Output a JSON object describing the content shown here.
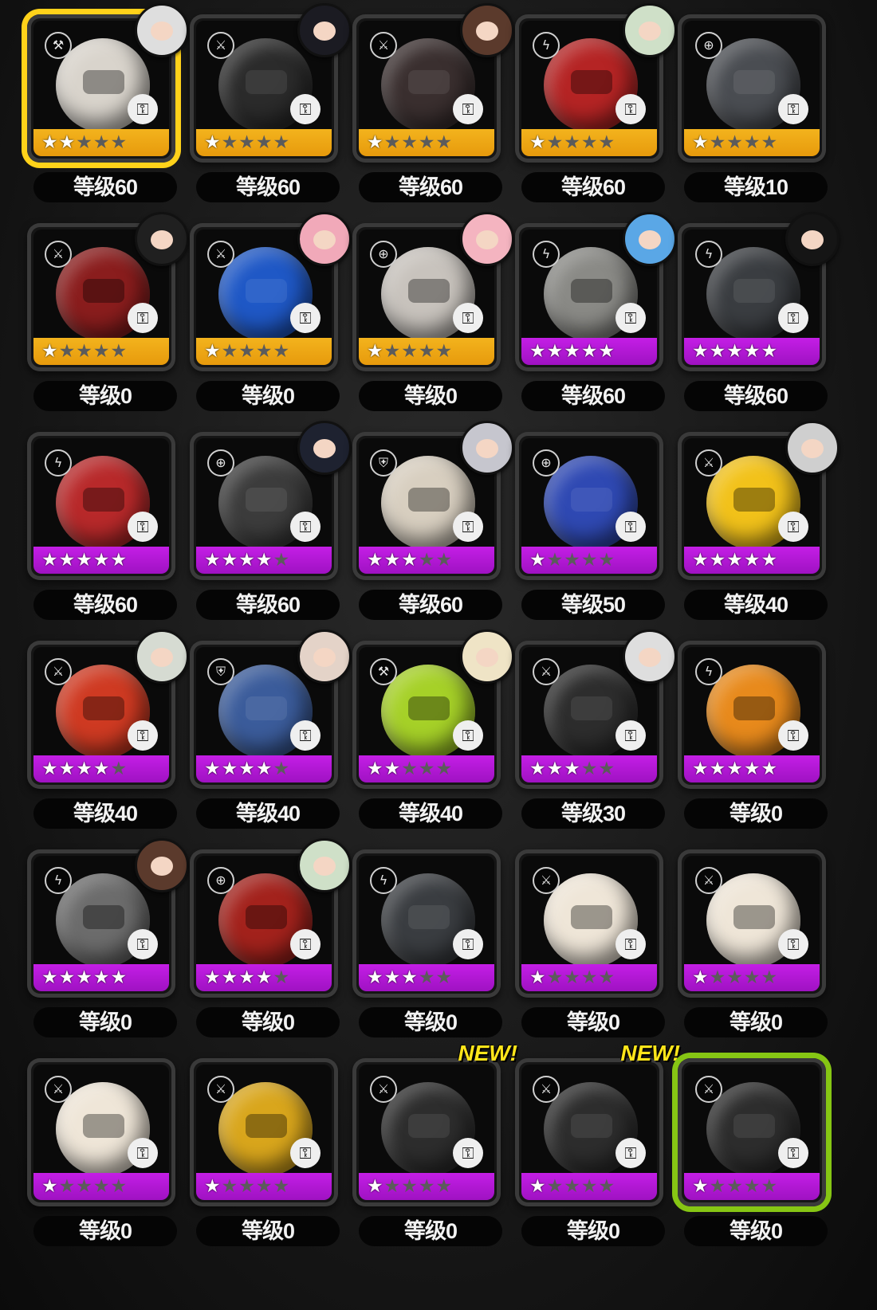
{
  "colors": {
    "rarity_a": "#e79a0c",
    "rarity_s": "#b317d6",
    "selected_yellow": "#ffd21a",
    "selected_green": "#86c614",
    "new_tag": "#ffe51a"
  },
  "cards": [
    {
      "level": "等级60",
      "stars": 2,
      "rarity": "orange",
      "type_icon": "hammer-icon",
      "avatar": true,
      "selected": "yellow",
      "ball": "#d9d4cc"
    },
    {
      "level": "等级60",
      "stars": 1,
      "rarity": "orange",
      "type_icon": "crossed-swords-icon",
      "avatar": true,
      "ball": "#2b2b2b"
    },
    {
      "level": "等级60",
      "stars": 1,
      "rarity": "orange",
      "type_icon": "crossed-swords-icon",
      "avatar": true,
      "ball": "#3a2f2f"
    },
    {
      "level": "等级60",
      "stars": 1,
      "rarity": "orange",
      "type_icon": "bolt-icon",
      "avatar": true,
      "ball": "#b52424"
    },
    {
      "level": "等级10",
      "stars": 1,
      "rarity": "orange",
      "type_icon": "crosshair-icon",
      "avatar": false,
      "ball": "#4a4d52"
    },
    {
      "level": "等级0",
      "stars": 1,
      "rarity": "orange",
      "type_icon": "crossed-swords-icon",
      "avatar": true,
      "ball": "#8a1d1d"
    },
    {
      "level": "等级0",
      "stars": 1,
      "rarity": "orange",
      "type_icon": "crossed-swords-icon",
      "avatar": true,
      "ball": "#1f58c6"
    },
    {
      "level": "等级0",
      "stars": 1,
      "rarity": "orange",
      "type_icon": "crosshair-icon",
      "avatar": true,
      "ball": "#c8c3bd"
    },
    {
      "level": "等级60",
      "stars": 5,
      "rarity": "purple",
      "type_icon": "bolt-icon",
      "avatar": true,
      "ball": "#8a8a86"
    },
    {
      "level": "等级60",
      "stars": 5,
      "rarity": "purple",
      "type_icon": "bolt-icon",
      "avatar": true,
      "ball": "#3a3d41"
    },
    {
      "level": "等级60",
      "stars": 5,
      "rarity": "purple",
      "type_icon": "bolt-icon",
      "avatar": false,
      "ball": "#b8292a"
    },
    {
      "level": "等级60",
      "stars": 4,
      "rarity": "purple",
      "type_icon": "crosshair-icon",
      "avatar": true,
      "ball": "#3c3c3c"
    },
    {
      "level": "等级60",
      "stars": 3,
      "rarity": "purple",
      "type_icon": "shield-icon",
      "avatar": true,
      "ball": "#d8cfc0"
    },
    {
      "level": "等级50",
      "stars": 1,
      "rarity": "purple",
      "type_icon": "crosshair-icon",
      "avatar": false,
      "ball": "#2f49b3"
    },
    {
      "level": "等级40",
      "stars": 5,
      "rarity": "purple",
      "type_icon": "crossed-swords-icon",
      "avatar": true,
      "ball": "#f2c21a"
    },
    {
      "level": "等级40",
      "stars": 4,
      "rarity": "purple",
      "type_icon": "crossed-swords-icon",
      "avatar": true,
      "ball": "#cf3a22"
    },
    {
      "level": "等级40",
      "stars": 4,
      "rarity": "purple",
      "type_icon": "shield-icon",
      "avatar": true,
      "ball": "#3b5c9b"
    },
    {
      "level": "等级40",
      "stars": 2,
      "rarity": "purple",
      "type_icon": "hammer-icon",
      "avatar": true,
      "ball": "#a6d128"
    },
    {
      "level": "等级30",
      "stars": 3,
      "rarity": "purple",
      "type_icon": "crossed-swords-icon",
      "avatar": true,
      "ball": "#2d2d2d"
    },
    {
      "level": "等级0",
      "stars": 5,
      "rarity": "purple",
      "type_icon": "bolt-icon",
      "avatar": false,
      "ball": "#e88a1c"
    },
    {
      "level": "等级0",
      "stars": 5,
      "rarity": "purple",
      "type_icon": "bolt-icon",
      "avatar": true,
      "ball": "#6c6c6c"
    },
    {
      "level": "等级0",
      "stars": 4,
      "rarity": "purple",
      "type_icon": "crosshair-icon",
      "avatar": true,
      "ball": "#a3221c"
    },
    {
      "level": "等级0",
      "stars": 3,
      "rarity": "purple",
      "type_icon": "bolt-icon",
      "avatar": false,
      "ball": "#3a3d41"
    },
    {
      "level": "等级0",
      "stars": 1,
      "rarity": "purple",
      "type_icon": "crossed-swords-icon",
      "avatar": false,
      "ball": "#efe6d8"
    },
    {
      "level": "等级0",
      "stars": 1,
      "rarity": "purple",
      "type_icon": "crossed-swords-icon",
      "avatar": false,
      "ball": "#efe6d8"
    },
    {
      "level": "等级0",
      "stars": 1,
      "rarity": "purple",
      "type_icon": "crossed-swords-icon",
      "avatar": false,
      "ball": "#efe6d8"
    },
    {
      "level": "等级0",
      "stars": 1,
      "rarity": "purple",
      "type_icon": "crossed-swords-icon",
      "avatar": false,
      "ball": "#d9a61c"
    },
    {
      "level": "等级0",
      "stars": 1,
      "rarity": "purple",
      "type_icon": "crossed-swords-icon",
      "avatar": false,
      "new_label": "NEW!",
      "ball": "#2d2d2d"
    },
    {
      "level": "等级0",
      "stars": 1,
      "rarity": "purple",
      "type_icon": "crossed-swords-icon",
      "avatar": false,
      "new_label": "NEW!",
      "ball": "#2d2d2d"
    },
    {
      "level": "等级0",
      "stars": 1,
      "rarity": "purple",
      "type_icon": "crossed-swords-icon",
      "avatar": false,
      "selected": "green",
      "ball": "#2d2d2d"
    }
  ]
}
